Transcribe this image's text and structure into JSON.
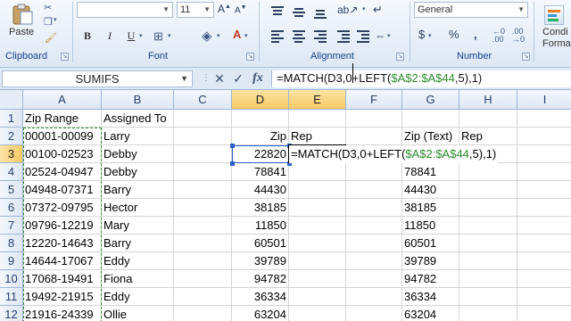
{
  "ribbon": {
    "clipboard": {
      "paste_label": "Paste",
      "group_label": "Clipboard"
    },
    "font": {
      "font_name": "",
      "font_size": "11",
      "bold_label": "B",
      "italic_label": "I",
      "underline_label": "U",
      "group_label": "Font"
    },
    "alignment": {
      "group_label": "Alignment"
    },
    "number": {
      "format": "General",
      "currency": "$",
      "percent": "%",
      "comma": ",",
      "group_label": "Number"
    },
    "styles": {
      "cond_label": "Condi",
      "format_label": "Forma"
    }
  },
  "formula_bar": {
    "name_box": "SUMIFS",
    "cancel": "✕",
    "enter": "✓",
    "fx": "fx",
    "formula_part1": "=MATCH(D3,0+LEFT(",
    "formula_ref": "$A$2:$A$44",
    "formula_part2": ",5),1)"
  },
  "columns": [
    "A",
    "B",
    "C",
    "D",
    "E",
    "F",
    "G",
    "H",
    "I"
  ],
  "rows": [
    {
      "num": "1",
      "A": "Zip Range",
      "B": "Assigned To",
      "D": "",
      "E": "",
      "G": "",
      "H": ""
    },
    {
      "num": "2",
      "A": "00001-00099",
      "B": "Larry",
      "D": "Zip",
      "E": "Rep",
      "G": "Zip (Text)",
      "H": "Rep"
    },
    {
      "num": "3",
      "A": "00100-02523",
      "B": "Debby",
      "D": "22820",
      "E": "",
      "G": "22820",
      "H": ""
    },
    {
      "num": "4",
      "A": "02524-04947",
      "B": "Debby",
      "D": "78841",
      "E": "",
      "G": "78841",
      "H": ""
    },
    {
      "num": "5",
      "A": "04948-07371",
      "B": "Barry",
      "D": "44430",
      "E": "",
      "G": "44430",
      "H": ""
    },
    {
      "num": "6",
      "A": "07372-09795",
      "B": "Hector",
      "D": "38185",
      "E": "",
      "G": "38185",
      "H": ""
    },
    {
      "num": "7",
      "A": "09796-12219",
      "B": "Mary",
      "D": "11850",
      "E": "",
      "G": "11850",
      "H": ""
    },
    {
      "num": "8",
      "A": "12220-14643",
      "B": "Barry",
      "D": "60501",
      "E": "",
      "G": "60501",
      "H": ""
    },
    {
      "num": "9",
      "A": "14644-17067",
      "B": "Eddy",
      "D": "39789",
      "E": "",
      "G": "39789",
      "H": ""
    },
    {
      "num": "10",
      "A": "17068-19491",
      "B": "Fiona",
      "D": "94782",
      "E": "",
      "G": "94782",
      "H": ""
    },
    {
      "num": "11",
      "A": "19492-21915",
      "B": "Eddy",
      "D": "36334",
      "E": "",
      "G": "36334",
      "H": ""
    },
    {
      "num": "12",
      "A": "21916-24339",
      "B": "Ollie",
      "D": "63204",
      "E": "",
      "G": "63204",
      "H": ""
    }
  ],
  "edit_cell": {
    "part1": "=MATCH(D3,0+LEFT(",
    "ref": "$A$2:$A$44",
    "part2": ",5),1)"
  }
}
